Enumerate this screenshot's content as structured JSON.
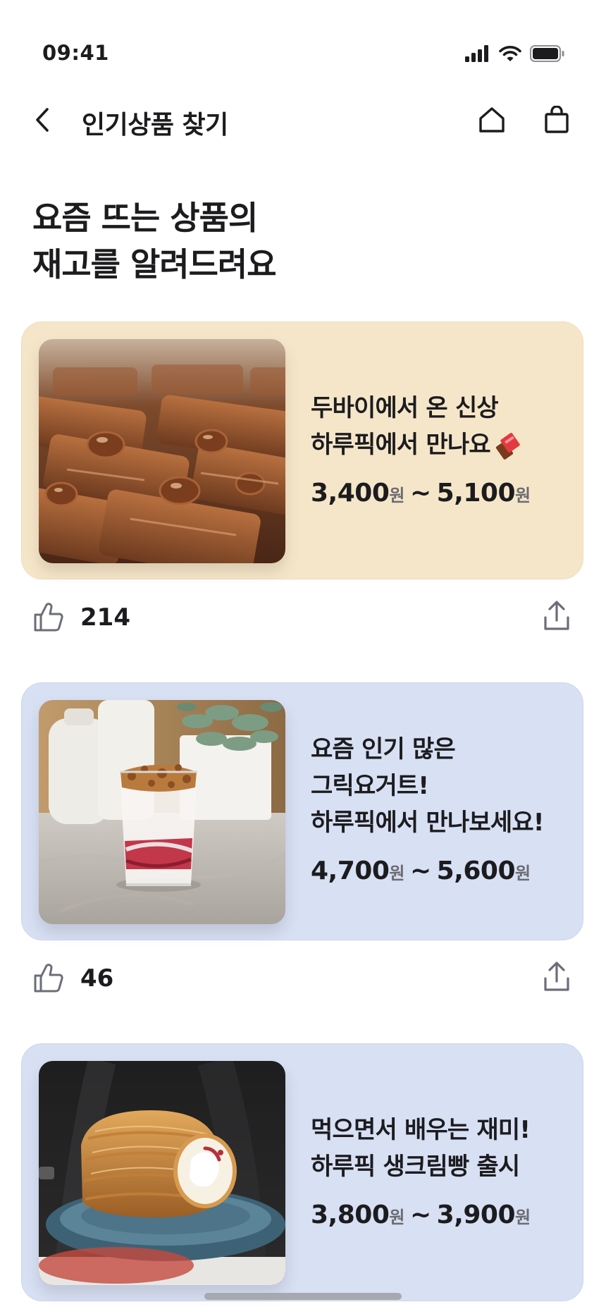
{
  "status_bar": {
    "time": "09:41"
  },
  "nav": {
    "title": "인기상품 찾기"
  },
  "headline": {
    "line1": "요즘 뜨는 상품의",
    "line2": "재고를 알려드려요"
  },
  "products": [
    {
      "title_line1": "두바이에서 온 신상",
      "title_line2": "하루픽에서 만나요",
      "title_emoji": "chocolate-bar-emoji",
      "price_min": "3,400",
      "price_max": "5,100",
      "currency": "원",
      "tilde": "~",
      "likes": "214",
      "bg_color": "#f6e6c9"
    },
    {
      "title_line1": "요즘 인기 많은",
      "title_line2": "그릭요거트!",
      "title_line3": "하루픽에서 만나보세요!",
      "price_min": "4,700",
      "price_max": "5,600",
      "currency": "원",
      "tilde": "~",
      "likes": "46",
      "bg_color": "#d8e0f4"
    },
    {
      "title_line1": "먹으면서 배우는 재미!",
      "title_line2": "하루픽 생크림빵 출시",
      "price_min": "3,800",
      "price_max": "3,900",
      "currency": "원",
      "tilde": "~",
      "bg_color": "#d8e0f4"
    }
  ],
  "icons": {
    "back": "chevron-left-icon",
    "home": "home-icon",
    "bag": "shopping-bag-icon",
    "like": "thumbs-up-icon",
    "share": "share-icon"
  }
}
